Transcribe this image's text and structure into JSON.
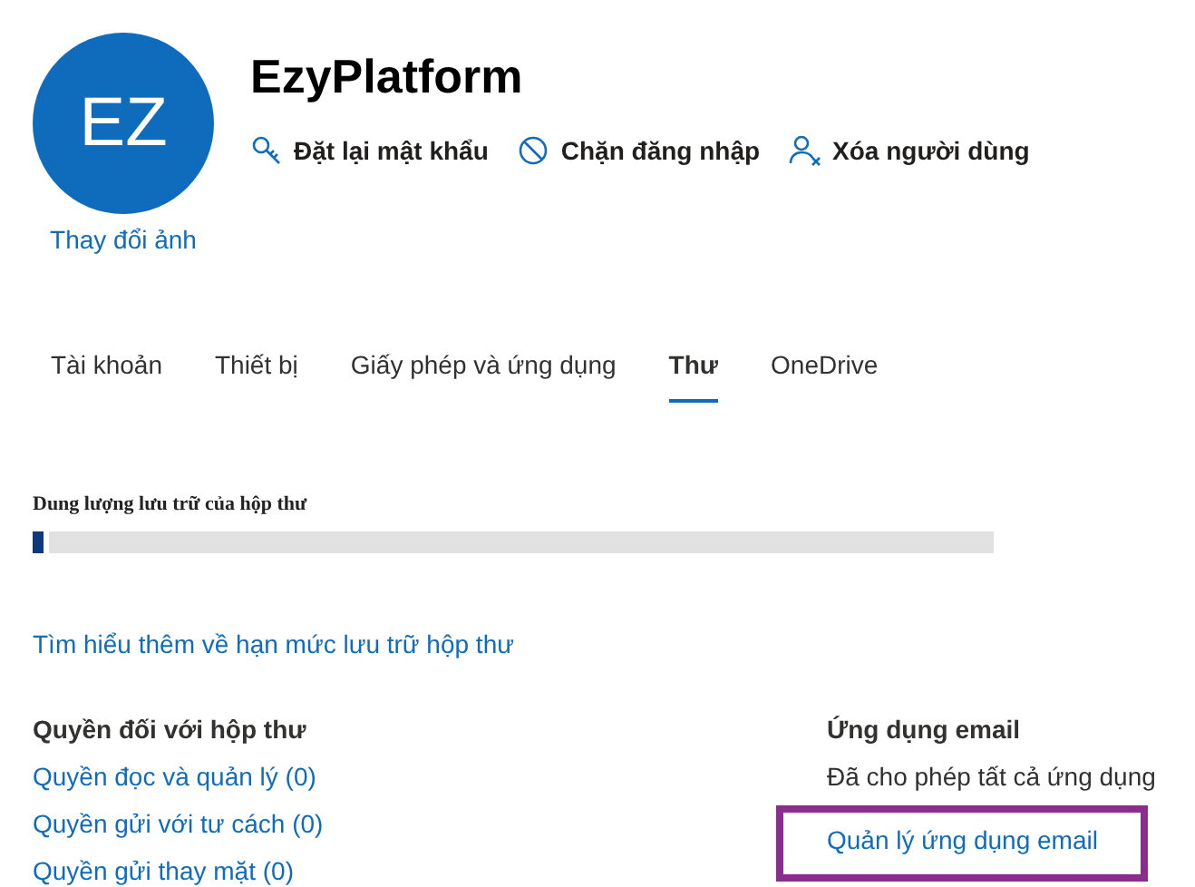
{
  "profile": {
    "initials": "EZ",
    "change_photo": "Thay đổi ảnh",
    "name": "EzyPlatform",
    "actions": [
      {
        "kind": "key",
        "label": "Đặt lại mật khẩu"
      },
      {
        "kind": "block",
        "label": "Chặn đăng nhập"
      },
      {
        "kind": "remove-user",
        "label": "Xóa người dùng"
      }
    ]
  },
  "tabs": [
    {
      "label": "Tài khoản",
      "selected": false
    },
    {
      "label": "Thiết bị",
      "selected": false
    },
    {
      "label": "Giấy phép và ứng dụng",
      "selected": false
    },
    {
      "label": "Thư",
      "selected": true
    },
    {
      "label": "OneDrive",
      "selected": false
    }
  ],
  "storage": {
    "label": "Dung lượng lưu trữ của hộp thư",
    "level": 0.015,
    "learn_more": "Tìm hiểu thêm về hạn mức lưu trữ hộp thư"
  },
  "mailbox_permissions": {
    "heading": "Quyền đối với hộp thư",
    "links": [
      "Quyền đọc và quản lý (0)",
      "Quyền gửi với tư cách (0)",
      "Quyền gửi thay mặt (0)"
    ]
  },
  "email_apps": {
    "heading": "Ứng dụng email",
    "status": "Đã cho phép tất cả ứng dụng",
    "manage_link": {
      "label": "Quản lý ứng dụng email",
      "highlighted": true
    }
  }
}
